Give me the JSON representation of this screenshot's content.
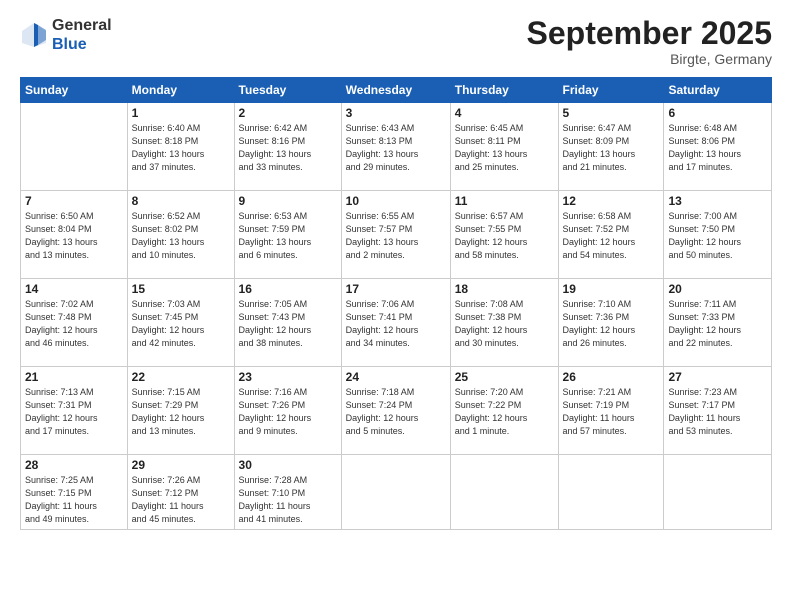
{
  "header": {
    "logo_general": "General",
    "logo_blue": "Blue",
    "month_title": "September 2025",
    "subtitle": "Birgte, Germany"
  },
  "days_of_week": [
    "Sunday",
    "Monday",
    "Tuesday",
    "Wednesday",
    "Thursday",
    "Friday",
    "Saturday"
  ],
  "weeks": [
    [
      {
        "day": "",
        "info": ""
      },
      {
        "day": "1",
        "info": "Sunrise: 6:40 AM\nSunset: 8:18 PM\nDaylight: 13 hours\nand 37 minutes."
      },
      {
        "day": "2",
        "info": "Sunrise: 6:42 AM\nSunset: 8:16 PM\nDaylight: 13 hours\nand 33 minutes."
      },
      {
        "day": "3",
        "info": "Sunrise: 6:43 AM\nSunset: 8:13 PM\nDaylight: 13 hours\nand 29 minutes."
      },
      {
        "day": "4",
        "info": "Sunrise: 6:45 AM\nSunset: 8:11 PM\nDaylight: 13 hours\nand 25 minutes."
      },
      {
        "day": "5",
        "info": "Sunrise: 6:47 AM\nSunset: 8:09 PM\nDaylight: 13 hours\nand 21 minutes."
      },
      {
        "day": "6",
        "info": "Sunrise: 6:48 AM\nSunset: 8:06 PM\nDaylight: 13 hours\nand 17 minutes."
      }
    ],
    [
      {
        "day": "7",
        "info": "Sunrise: 6:50 AM\nSunset: 8:04 PM\nDaylight: 13 hours\nand 13 minutes."
      },
      {
        "day": "8",
        "info": "Sunrise: 6:52 AM\nSunset: 8:02 PM\nDaylight: 13 hours\nand 10 minutes."
      },
      {
        "day": "9",
        "info": "Sunrise: 6:53 AM\nSunset: 7:59 PM\nDaylight: 13 hours\nand 6 minutes."
      },
      {
        "day": "10",
        "info": "Sunrise: 6:55 AM\nSunset: 7:57 PM\nDaylight: 13 hours\nand 2 minutes."
      },
      {
        "day": "11",
        "info": "Sunrise: 6:57 AM\nSunset: 7:55 PM\nDaylight: 12 hours\nand 58 minutes."
      },
      {
        "day": "12",
        "info": "Sunrise: 6:58 AM\nSunset: 7:52 PM\nDaylight: 12 hours\nand 54 minutes."
      },
      {
        "day": "13",
        "info": "Sunrise: 7:00 AM\nSunset: 7:50 PM\nDaylight: 12 hours\nand 50 minutes."
      }
    ],
    [
      {
        "day": "14",
        "info": "Sunrise: 7:02 AM\nSunset: 7:48 PM\nDaylight: 12 hours\nand 46 minutes."
      },
      {
        "day": "15",
        "info": "Sunrise: 7:03 AM\nSunset: 7:45 PM\nDaylight: 12 hours\nand 42 minutes."
      },
      {
        "day": "16",
        "info": "Sunrise: 7:05 AM\nSunset: 7:43 PM\nDaylight: 12 hours\nand 38 minutes."
      },
      {
        "day": "17",
        "info": "Sunrise: 7:06 AM\nSunset: 7:41 PM\nDaylight: 12 hours\nand 34 minutes."
      },
      {
        "day": "18",
        "info": "Sunrise: 7:08 AM\nSunset: 7:38 PM\nDaylight: 12 hours\nand 30 minutes."
      },
      {
        "day": "19",
        "info": "Sunrise: 7:10 AM\nSunset: 7:36 PM\nDaylight: 12 hours\nand 26 minutes."
      },
      {
        "day": "20",
        "info": "Sunrise: 7:11 AM\nSunset: 7:33 PM\nDaylight: 12 hours\nand 22 minutes."
      }
    ],
    [
      {
        "day": "21",
        "info": "Sunrise: 7:13 AM\nSunset: 7:31 PM\nDaylight: 12 hours\nand 17 minutes."
      },
      {
        "day": "22",
        "info": "Sunrise: 7:15 AM\nSunset: 7:29 PM\nDaylight: 12 hours\nand 13 minutes."
      },
      {
        "day": "23",
        "info": "Sunrise: 7:16 AM\nSunset: 7:26 PM\nDaylight: 12 hours\nand 9 minutes."
      },
      {
        "day": "24",
        "info": "Sunrise: 7:18 AM\nSunset: 7:24 PM\nDaylight: 12 hours\nand 5 minutes."
      },
      {
        "day": "25",
        "info": "Sunrise: 7:20 AM\nSunset: 7:22 PM\nDaylight: 12 hours\nand 1 minute."
      },
      {
        "day": "26",
        "info": "Sunrise: 7:21 AM\nSunset: 7:19 PM\nDaylight: 11 hours\nand 57 minutes."
      },
      {
        "day": "27",
        "info": "Sunrise: 7:23 AM\nSunset: 7:17 PM\nDaylight: 11 hours\nand 53 minutes."
      }
    ],
    [
      {
        "day": "28",
        "info": "Sunrise: 7:25 AM\nSunset: 7:15 PM\nDaylight: 11 hours\nand 49 minutes."
      },
      {
        "day": "29",
        "info": "Sunrise: 7:26 AM\nSunset: 7:12 PM\nDaylight: 11 hours\nand 45 minutes."
      },
      {
        "day": "30",
        "info": "Sunrise: 7:28 AM\nSunset: 7:10 PM\nDaylight: 11 hours\nand 41 minutes."
      },
      {
        "day": "",
        "info": ""
      },
      {
        "day": "",
        "info": ""
      },
      {
        "day": "",
        "info": ""
      },
      {
        "day": "",
        "info": ""
      }
    ]
  ]
}
